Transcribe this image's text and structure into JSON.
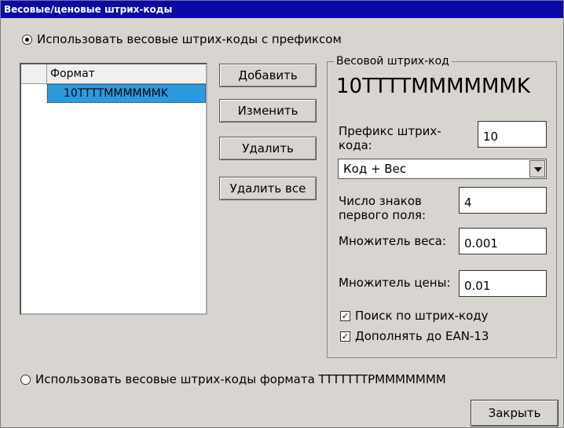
{
  "window": {
    "title": "Весовые/ценовые штрих-коды"
  },
  "radio_prefix": {
    "label": "Использовать весовые штрих-коды с префиксом",
    "checked": true
  },
  "list": {
    "header": "Формат",
    "rows": [
      "10TTTTMMMMMMK"
    ]
  },
  "buttons": {
    "add": "Добавить",
    "edit": "Изменить",
    "delete": "Удалить",
    "delete_all": "Удалить все"
  },
  "group": {
    "title": "Весовой штрих-код",
    "format_display": "10TTTTMMMMMMK",
    "prefix_label_line1": "Префикс штрих-",
    "prefix_label_line2": "кода:",
    "prefix_value": "10",
    "mode_select": "Код + Вес",
    "first_field_label_line1": "Число знаков",
    "first_field_label_line2": "первого поля:",
    "first_field_value": "4",
    "weight_mult_label": "Множитель веса:",
    "weight_mult_value": "0.001",
    "price_mult_label": "Множитель цены:",
    "price_mult_value": "0.01",
    "search_label": "Поиск по штрих-коду",
    "ean_label": "Дополнять до EAN-13"
  },
  "radio_format": {
    "label": "Использовать весовые штрих-коды формата TTTTTTTPMMMMMMM",
    "checked": false
  },
  "close_button": "Закрыть"
}
